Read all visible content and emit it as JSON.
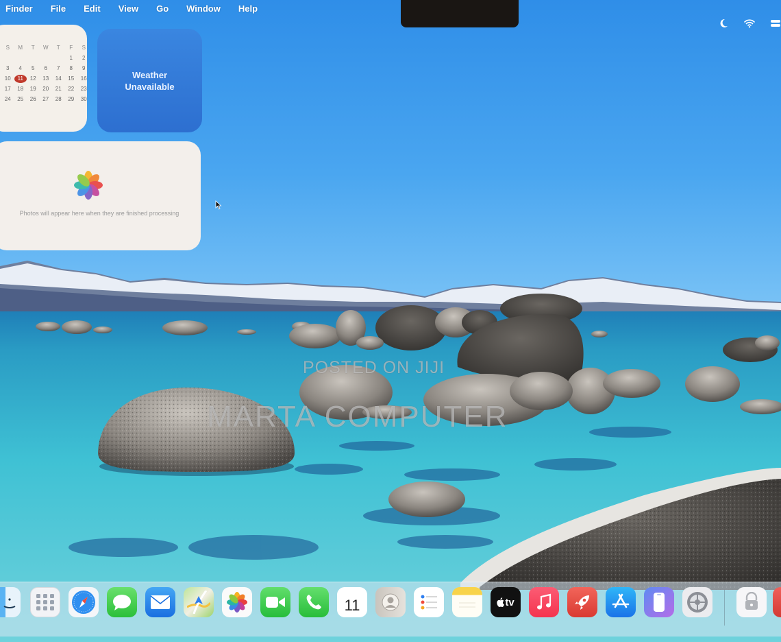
{
  "menubar": {
    "items": [
      "Finder",
      "File",
      "Edit",
      "View",
      "Go",
      "Window",
      "Help"
    ],
    "status_icons": [
      "moon-icon",
      "wifi-icon",
      "control-center-icon"
    ]
  },
  "widgets": {
    "calendar": {
      "month_label": "",
      "weekday_headers": [
        "S",
        "M",
        "T",
        "W",
        "T",
        "F",
        "S"
      ],
      "rows": [
        [
          "",
          "",
          "",
          "",
          "",
          "1",
          "2"
        ],
        [
          "3",
          "4",
          "5",
          "6",
          "7",
          "8",
          "9"
        ],
        [
          "10",
          "11",
          "12",
          "13",
          "14",
          "15",
          "16"
        ],
        [
          "17",
          "18",
          "19",
          "20",
          "21",
          "22",
          "23"
        ],
        [
          "24",
          "25",
          "26",
          "27",
          "28",
          "29",
          "30"
        ]
      ],
      "today": "11"
    },
    "weather": {
      "text": "Weather Unavailable"
    },
    "photos": {
      "text": "Photos will appear here when they are finished processing"
    }
  },
  "watermark": {
    "line1": "POSTED ON JIJI",
    "line2": "MARTA COMPUTER"
  },
  "dock": {
    "apps": [
      "finder-icon",
      "launchpad-icon",
      "safari-icon",
      "messages-icon",
      "mail-icon",
      "maps-icon",
      "photos-icon",
      "facetime-icon",
      "phone-icon",
      "calendar-icon",
      "contacts-icon",
      "reminders-icon",
      "notes-icon",
      "apple-tv-icon",
      "music-icon",
      "rocket-icon",
      "app-store-icon",
      "iphone-mirroring-icon",
      "system-settings-icon",
      "preview-icon"
    ],
    "calendar_date": "11",
    "tv_label": "tv"
  }
}
